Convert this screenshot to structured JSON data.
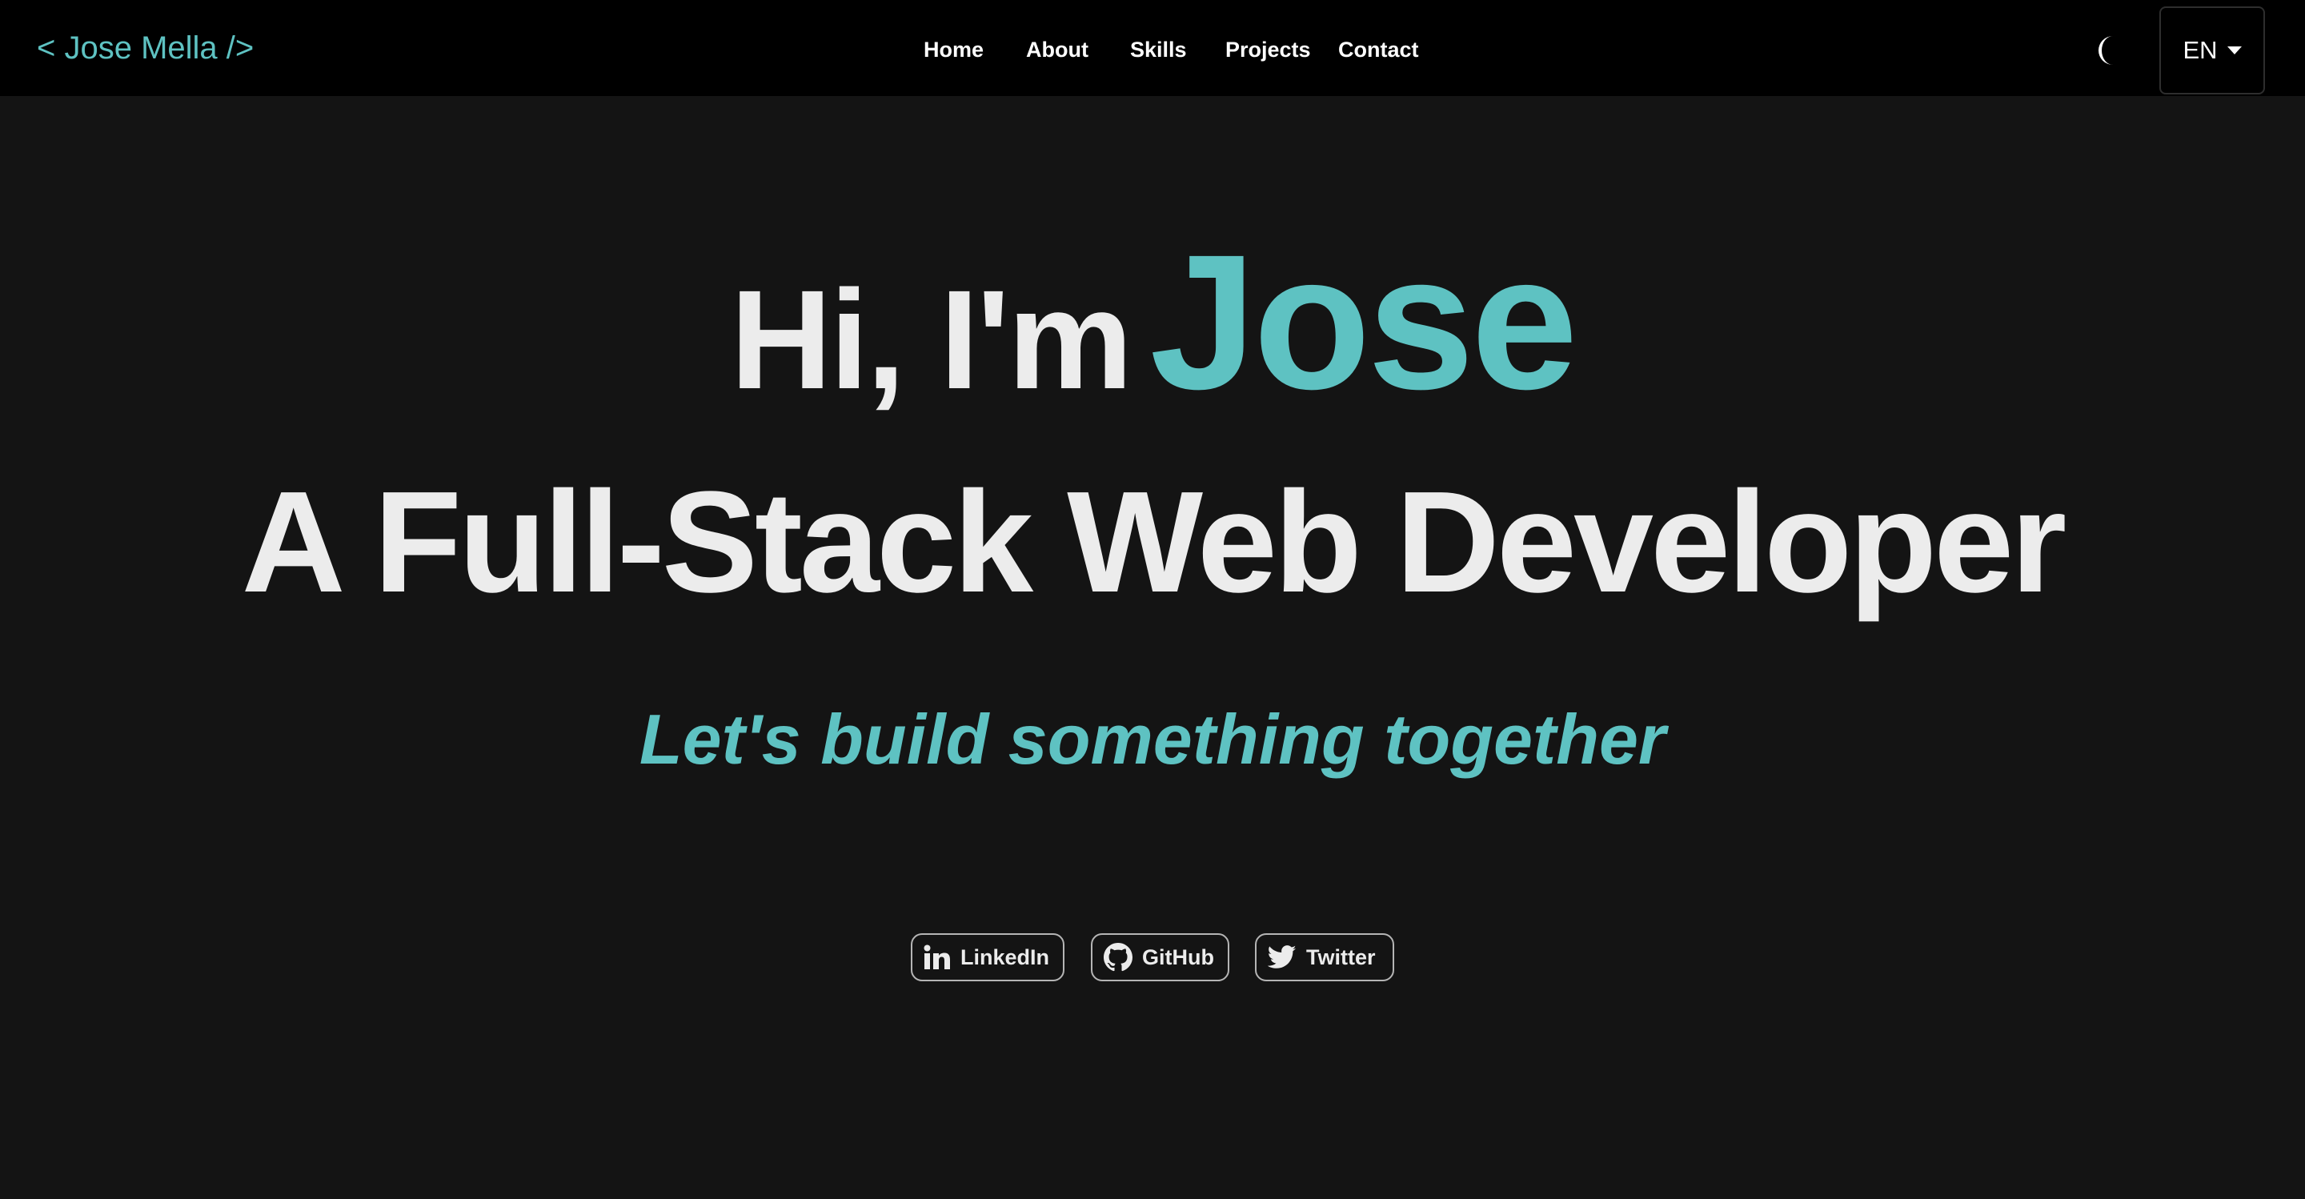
{
  "navbar": {
    "brand": "< Jose Mella />",
    "links": [
      {
        "label": "Home"
      },
      {
        "label": "About"
      },
      {
        "label": "Skills"
      },
      {
        "label": "Projects"
      },
      {
        "label": "Contact"
      }
    ],
    "theme_icon": "moon-icon",
    "language": {
      "selected": "EN",
      "icon": "caret-down-icon"
    }
  },
  "hero": {
    "greeting": "Hi, I'm",
    "name": "Jose",
    "role": "A Full-Stack Web Developer",
    "tagline": "Let's build something together"
  },
  "social": [
    {
      "label": "LinkedIn",
      "icon": "linkedin-icon"
    },
    {
      "label": "GitHub",
      "icon": "github-icon"
    },
    {
      "label": "Twitter",
      "icon": "twitter-icon"
    }
  ],
  "colors": {
    "accent": "#5ec2c2",
    "background": "#141414",
    "navbar": "#000000",
    "text": "#ececec"
  }
}
